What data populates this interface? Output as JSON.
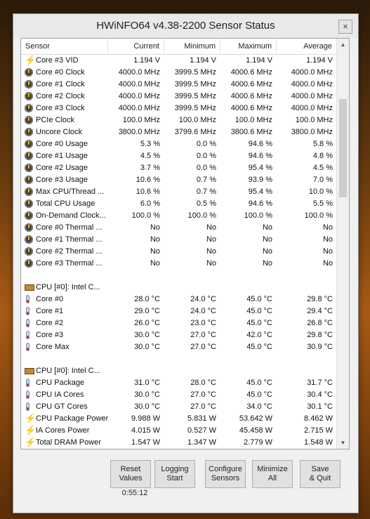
{
  "window": {
    "title": "HWiNFO64 v4.38-2200 Sensor Status",
    "close_label": "×"
  },
  "columns": [
    "Sensor",
    "Current",
    "Minimum",
    "Maximum",
    "Average"
  ],
  "rows": [
    {
      "icon": "bolt",
      "name": "Core #3 VID",
      "cur": "1.194 V",
      "min": "1.194 V",
      "max": "1.194 V",
      "avg": "1.194 V"
    },
    {
      "icon": "clock",
      "name": "Core #0 Clock",
      "cur": "4000.0 MHz",
      "min": "3999.5 MHz",
      "max": "4000.6 MHz",
      "avg": "4000.0 MHz"
    },
    {
      "icon": "clock",
      "name": "Core #1 Clock",
      "cur": "4000.0 MHz",
      "min": "3999.5 MHz",
      "max": "4000.6 MHz",
      "avg": "4000.0 MHz"
    },
    {
      "icon": "clock",
      "name": "Core #2 Clock",
      "cur": "4000.0 MHz",
      "min": "3999.5 MHz",
      "max": "4000.6 MHz",
      "avg": "4000.0 MHz"
    },
    {
      "icon": "clock",
      "name": "Core #3 Clock",
      "cur": "4000.0 MHz",
      "min": "3999.5 MHz",
      "max": "4000.6 MHz",
      "avg": "4000.0 MHz"
    },
    {
      "icon": "clock",
      "name": "PCIe Clock",
      "cur": "100.0 MHz",
      "min": "100.0 MHz",
      "max": "100.0 MHz",
      "avg": "100.0 MHz"
    },
    {
      "icon": "clock",
      "name": "Uncore Clock",
      "cur": "3800.0 MHz",
      "min": "3799.6 MHz",
      "max": "3800.6 MHz",
      "avg": "3800.0 MHz"
    },
    {
      "icon": "clock",
      "name": "Core #0 Usage",
      "cur": "5.3 %",
      "min": "0.0 %",
      "max": "94.6 %",
      "avg": "5.8 %"
    },
    {
      "icon": "clock",
      "name": "Core #1 Usage",
      "cur": "4.5 %",
      "min": "0.0 %",
      "max": "94.6 %",
      "avg": "4.8 %"
    },
    {
      "icon": "clock",
      "name": "Core #2 Usage",
      "cur": "3.7 %",
      "min": "0.0 %",
      "max": "95.4 %",
      "avg": "4.5 %"
    },
    {
      "icon": "clock",
      "name": "Core #3 Usage",
      "cur": "10.6 %",
      "min": "0.7 %",
      "max": "93.9 %",
      "avg": "7.0 %"
    },
    {
      "icon": "clock",
      "name": "Max CPU/Thread ...",
      "cur": "10.6 %",
      "min": "0.7 %",
      "max": "95.4 %",
      "avg": "10.0 %"
    },
    {
      "icon": "clock",
      "name": "Total CPU Usage",
      "cur": "6.0 %",
      "min": "0.5 %",
      "max": "94.6 %",
      "avg": "5.5 %"
    },
    {
      "icon": "clock",
      "name": "On-Demand Clock...",
      "cur": "100.0 %",
      "min": "100.0 %",
      "max": "100.0 %",
      "avg": "100.0 %"
    },
    {
      "icon": "clock",
      "name": "Core #0 Thermal ...",
      "cur": "No",
      "min": "No",
      "max": "No",
      "avg": "No"
    },
    {
      "icon": "clock",
      "name": "Core #1 Thermal ...",
      "cur": "No",
      "min": "No",
      "max": "No",
      "avg": "No"
    },
    {
      "icon": "clock",
      "name": "Core #2 Thermal ...",
      "cur": "No",
      "min": "No",
      "max": "No",
      "avg": "No"
    },
    {
      "icon": "clock",
      "name": "Core #3 Thermal ...",
      "cur": "No",
      "min": "No",
      "max": "No",
      "avg": "No"
    },
    {
      "gap": true
    },
    {
      "icon": "chip",
      "name": "CPU [#0]: Intel C...",
      "cur": "",
      "min": "",
      "max": "",
      "avg": ""
    },
    {
      "icon": "therm",
      "name": "Core #0",
      "cur": "28.0 °C",
      "min": "24.0 °C",
      "max": "45.0 °C",
      "avg": "29.8 °C"
    },
    {
      "icon": "therm",
      "name": "Core #1",
      "cur": "29.0 °C",
      "min": "24.0 °C",
      "max": "45.0 °C",
      "avg": "29.4 °C"
    },
    {
      "icon": "therm",
      "name": "Core #2",
      "cur": "26.0 °C",
      "min": "23.0 °C",
      "max": "45.0 °C",
      "avg": "26.8 °C"
    },
    {
      "icon": "therm",
      "name": "Core #3",
      "cur": "30.0 °C",
      "min": "27.0 °C",
      "max": "42.0 °C",
      "avg": "29.8 °C"
    },
    {
      "icon": "therm",
      "name": "Core Max",
      "cur": "30.0 °C",
      "min": "27.0 °C",
      "max": "45.0 °C",
      "avg": "30.9 °C"
    },
    {
      "gap": true
    },
    {
      "icon": "chip",
      "name": "CPU [#0]: Intel C...",
      "cur": "",
      "min": "",
      "max": "",
      "avg": ""
    },
    {
      "icon": "therm",
      "name": "CPU Package",
      "cur": "31.0 °C",
      "min": "28.0 °C",
      "max": "45.0 °C",
      "avg": "31.7 °C"
    },
    {
      "icon": "therm",
      "name": "CPU IA Cores",
      "cur": "30.0 °C",
      "min": "27.0 °C",
      "max": "45.0 °C",
      "avg": "30.4 °C"
    },
    {
      "icon": "therm",
      "name": "CPU GT Cores",
      "cur": "30.0 °C",
      "min": "27.0 °C",
      "max": "34.0 °C",
      "avg": "30.1 °C"
    },
    {
      "icon": "bolt",
      "name": "CPU Package Power",
      "cur": "9.988 W",
      "min": "5.831 W",
      "max": "53.642 W",
      "avg": "8.462 W"
    },
    {
      "icon": "bolt",
      "name": "IA Cores Power",
      "cur": "4.015 W",
      "min": "0.527 W",
      "max": "45.458 W",
      "avg": "2.715 W"
    },
    {
      "icon": "bolt",
      "name": "Total DRAM Power",
      "cur": "1.547 W",
      "min": "1.347 W",
      "max": "2.779 W",
      "avg": "1.548 W"
    }
  ],
  "buttons": {
    "reset": "Reset\nValues",
    "logging": "Logging\nStart",
    "configure": "Configure\nSensors",
    "minimize": "Minimize\nAll",
    "save": "Save\n& Quit"
  },
  "timer": "0:55:12",
  "scrollbar": {
    "up": "▲",
    "down": "▼"
  }
}
